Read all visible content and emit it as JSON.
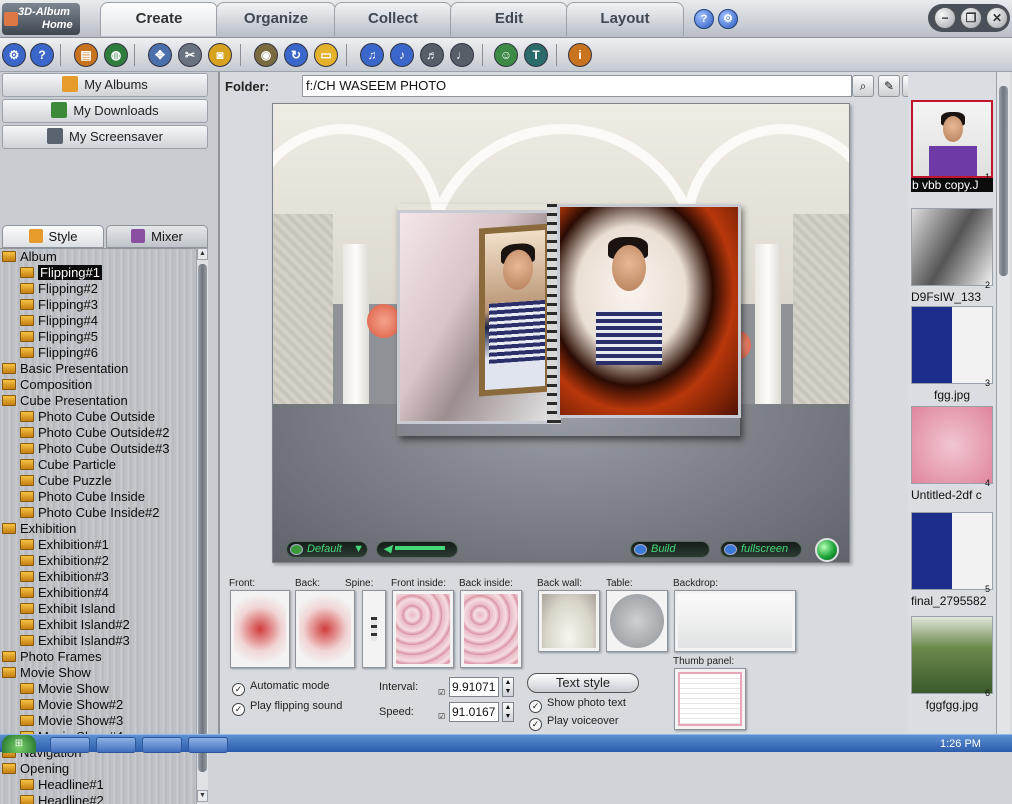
{
  "app": {
    "logo_line1": "3D-Album",
    "logo_line2": "Home"
  },
  "tabs": [
    {
      "label": "Create"
    },
    {
      "label": "Organize"
    },
    {
      "label": "Collect"
    },
    {
      "label": "Edit"
    },
    {
      "label": "Layout"
    }
  ],
  "title_buttons": {
    "help": "?",
    "options": "⚙"
  },
  "window_controls": {
    "minimize": "−",
    "restore": "❐",
    "close": "✕"
  },
  "toolbar_icons": [
    "gear-icon",
    "help-icon",
    "album-box-icon",
    "globe-icon",
    "move-icon",
    "tools-icon",
    "camera-icon",
    "disk-icon",
    "refresh-icon",
    "folder-icon",
    "music-icon",
    "music-add-icon",
    "music-disk-icon",
    "music-delete-icon",
    "user-icon",
    "text-icon",
    "info-icon"
  ],
  "left": {
    "nav": [
      {
        "label": "My Albums"
      },
      {
        "label": "My Downloads"
      },
      {
        "label": "My Screensaver"
      }
    ],
    "subtabs": [
      {
        "label": "Style"
      },
      {
        "label": "Mixer"
      }
    ],
    "tree": [
      {
        "label": "Album",
        "level": 0
      },
      {
        "label": "Flipping#1",
        "level": 1,
        "selected": true
      },
      {
        "label": "Flipping#2",
        "level": 1
      },
      {
        "label": "Flipping#3",
        "level": 1
      },
      {
        "label": "Flipping#4",
        "level": 1
      },
      {
        "label": "Flipping#5",
        "level": 1
      },
      {
        "label": "Flipping#6",
        "level": 1
      },
      {
        "label": "Basic Presentation",
        "level": 0
      },
      {
        "label": "Composition",
        "level": 0
      },
      {
        "label": "Cube Presentation",
        "level": 0
      },
      {
        "label": "Photo Cube Outside",
        "level": 1
      },
      {
        "label": "Photo Cube Outside#2",
        "level": 1
      },
      {
        "label": "Photo Cube Outside#3",
        "level": 1
      },
      {
        "label": "Cube Particle",
        "level": 1
      },
      {
        "label": "Cube Puzzle",
        "level": 1
      },
      {
        "label": "Photo Cube Inside",
        "level": 1
      },
      {
        "label": "Photo Cube Inside#2",
        "level": 1
      },
      {
        "label": "Exhibition",
        "level": 0
      },
      {
        "label": "Exhibition#1",
        "level": 1
      },
      {
        "label": "Exhibition#2",
        "level": 1
      },
      {
        "label": "Exhibition#3",
        "level": 1
      },
      {
        "label": "Exhibition#4",
        "level": 1
      },
      {
        "label": "Exhibit Island",
        "level": 1
      },
      {
        "label": "Exhibit Island#2",
        "level": 1
      },
      {
        "label": "Exhibit Island#3",
        "level": 1
      },
      {
        "label": "Photo Frames",
        "level": 0
      },
      {
        "label": "Movie Show",
        "level": 0
      },
      {
        "label": "Movie Show",
        "level": 1
      },
      {
        "label": "Movie Show#2",
        "level": 1
      },
      {
        "label": "Movie Show#3",
        "level": 1
      },
      {
        "label": "Movie Show#4",
        "level": 1
      },
      {
        "label": "Navigation",
        "level": 0
      },
      {
        "label": "Opening",
        "level": 0
      },
      {
        "label": "Headline#1",
        "level": 1
      },
      {
        "label": "Headline#2",
        "level": 1
      }
    ]
  },
  "folder": {
    "label": "Folder:",
    "path": "f:/CH  WASEEM  PHOTO"
  },
  "preview_bar": {
    "style_label": "Default",
    "build_label": "Build",
    "fullscreen_label": "fullscreen"
  },
  "slots": [
    {
      "label": "Front:"
    },
    {
      "label": "Back:"
    },
    {
      "label": "Spine:"
    },
    {
      "label": "Front inside:"
    },
    {
      "label": "Back inside:"
    },
    {
      "label": "Back wall:"
    },
    {
      "label": "Table:"
    },
    {
      "label": "Backdrop:"
    }
  ],
  "thumb_panel_label": "Thumb panel:",
  "options": {
    "automatic_mode": "Automatic mode",
    "play_flipping_sound": "Play flipping sound",
    "interval_label": "Interval:",
    "interval_value": "9.91071",
    "speed_label": "Speed:",
    "speed_value": "91.0167",
    "text_style_button": "Text style",
    "show_photo_text": "Show photo text",
    "play_voiceover": "Play voiceover"
  },
  "thumbnails": [
    {
      "num": "1",
      "caption": "b vbb copy.J",
      "selected": true
    },
    {
      "num": "2",
      "caption": "D9FsIW_133"
    },
    {
      "num": "3",
      "caption": "fgg.jpg"
    },
    {
      "num": "4",
      "caption": "Untitled-2df c"
    },
    {
      "num": "5",
      "caption": "final_2795582"
    },
    {
      "num": "6",
      "caption": "fggfgg.jpg"
    }
  ],
  "taskbar": {
    "clock": "1:26 PM"
  }
}
